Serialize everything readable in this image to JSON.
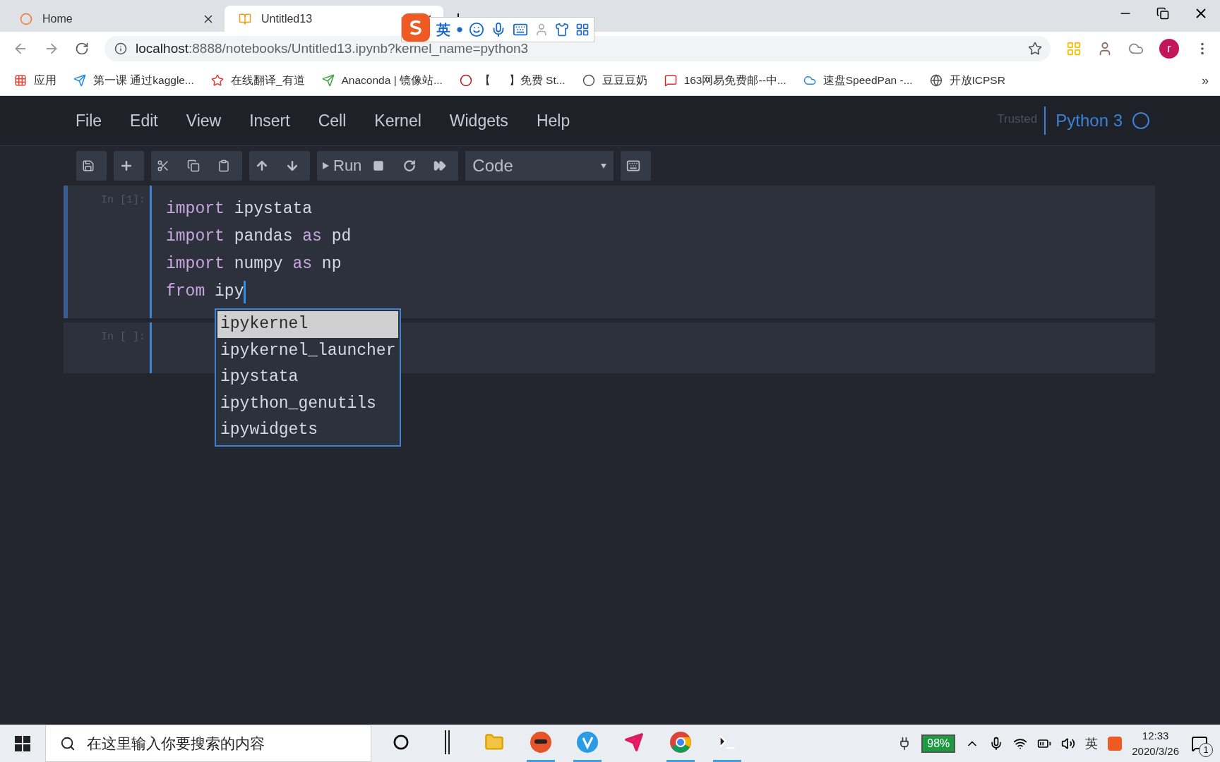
{
  "browser": {
    "tabs": [
      {
        "title": "Home",
        "selected": false
      },
      {
        "title": "Untitled13",
        "selected": true
      }
    ],
    "address": {
      "host": "localhost",
      "path": ":8888/notebooks/Untitled13.ipynb?kernel_name=python3"
    },
    "profile_initial": "r",
    "bookmarks": [
      {
        "label": "应用"
      },
      {
        "label": "第一课 通过kaggle..."
      },
      {
        "label": "在线翻译_有道"
      },
      {
        "label": "Anaconda | 镜像站..."
      },
      {
        "label": "【      】免费 St..."
      },
      {
        "label": "豆豆豆奶"
      },
      {
        "label": "163网易免费邮--中..."
      },
      {
        "label": "速盘SpeedPan -..."
      },
      {
        "label": "开放ICPSR"
      }
    ],
    "bookmarks_more": "»"
  },
  "ime_toolbar": {
    "mode": "英"
  },
  "notebook": {
    "menu": [
      "File",
      "Edit",
      "View",
      "Insert",
      "Cell",
      "Kernel",
      "Widgets",
      "Help"
    ],
    "trusted": "Trusted",
    "kernel": "Python 3",
    "toolbar": {
      "run": "Run",
      "cell_type": "Code"
    },
    "cells": [
      {
        "prompt": "In [1]:",
        "selected": true,
        "cursor": true,
        "lines": [
          [
            {
              "text": "import",
              "kind": "keyword"
            },
            {
              "text": " ipystata",
              "kind": "name"
            }
          ],
          [
            {
              "text": "import",
              "kind": "keyword"
            },
            {
              "text": " pandas ",
              "kind": "name"
            },
            {
              "text": "as",
              "kind": "keyword"
            },
            {
              "text": " pd",
              "kind": "name"
            }
          ],
          [
            {
              "text": "import",
              "kind": "keyword"
            },
            {
              "text": " numpy ",
              "kind": "name"
            },
            {
              "text": "as",
              "kind": "keyword"
            },
            {
              "text": " np",
              "kind": "name"
            }
          ],
          [
            {
              "text": "from",
              "kind": "keyword"
            },
            {
              "text": " ipy",
              "kind": "name"
            }
          ]
        ]
      },
      {
        "prompt": "In [ ]:",
        "selected": false
      }
    ],
    "completions": [
      {
        "text": "ipykernel",
        "selected": true
      },
      {
        "text": "ipykernel_launcher",
        "selected": false
      },
      {
        "text": "ipystata",
        "selected": false
      },
      {
        "text": "ipython_genutils",
        "selected": false
      },
      {
        "text": "ipywidgets",
        "selected": false
      }
    ]
  },
  "taskbar": {
    "search_placeholder": "在这里输入你要搜索的内容",
    "battery": "98%",
    "ime": "英",
    "time": "12:33",
    "date": "2020/3/26",
    "notifications": "1"
  }
}
